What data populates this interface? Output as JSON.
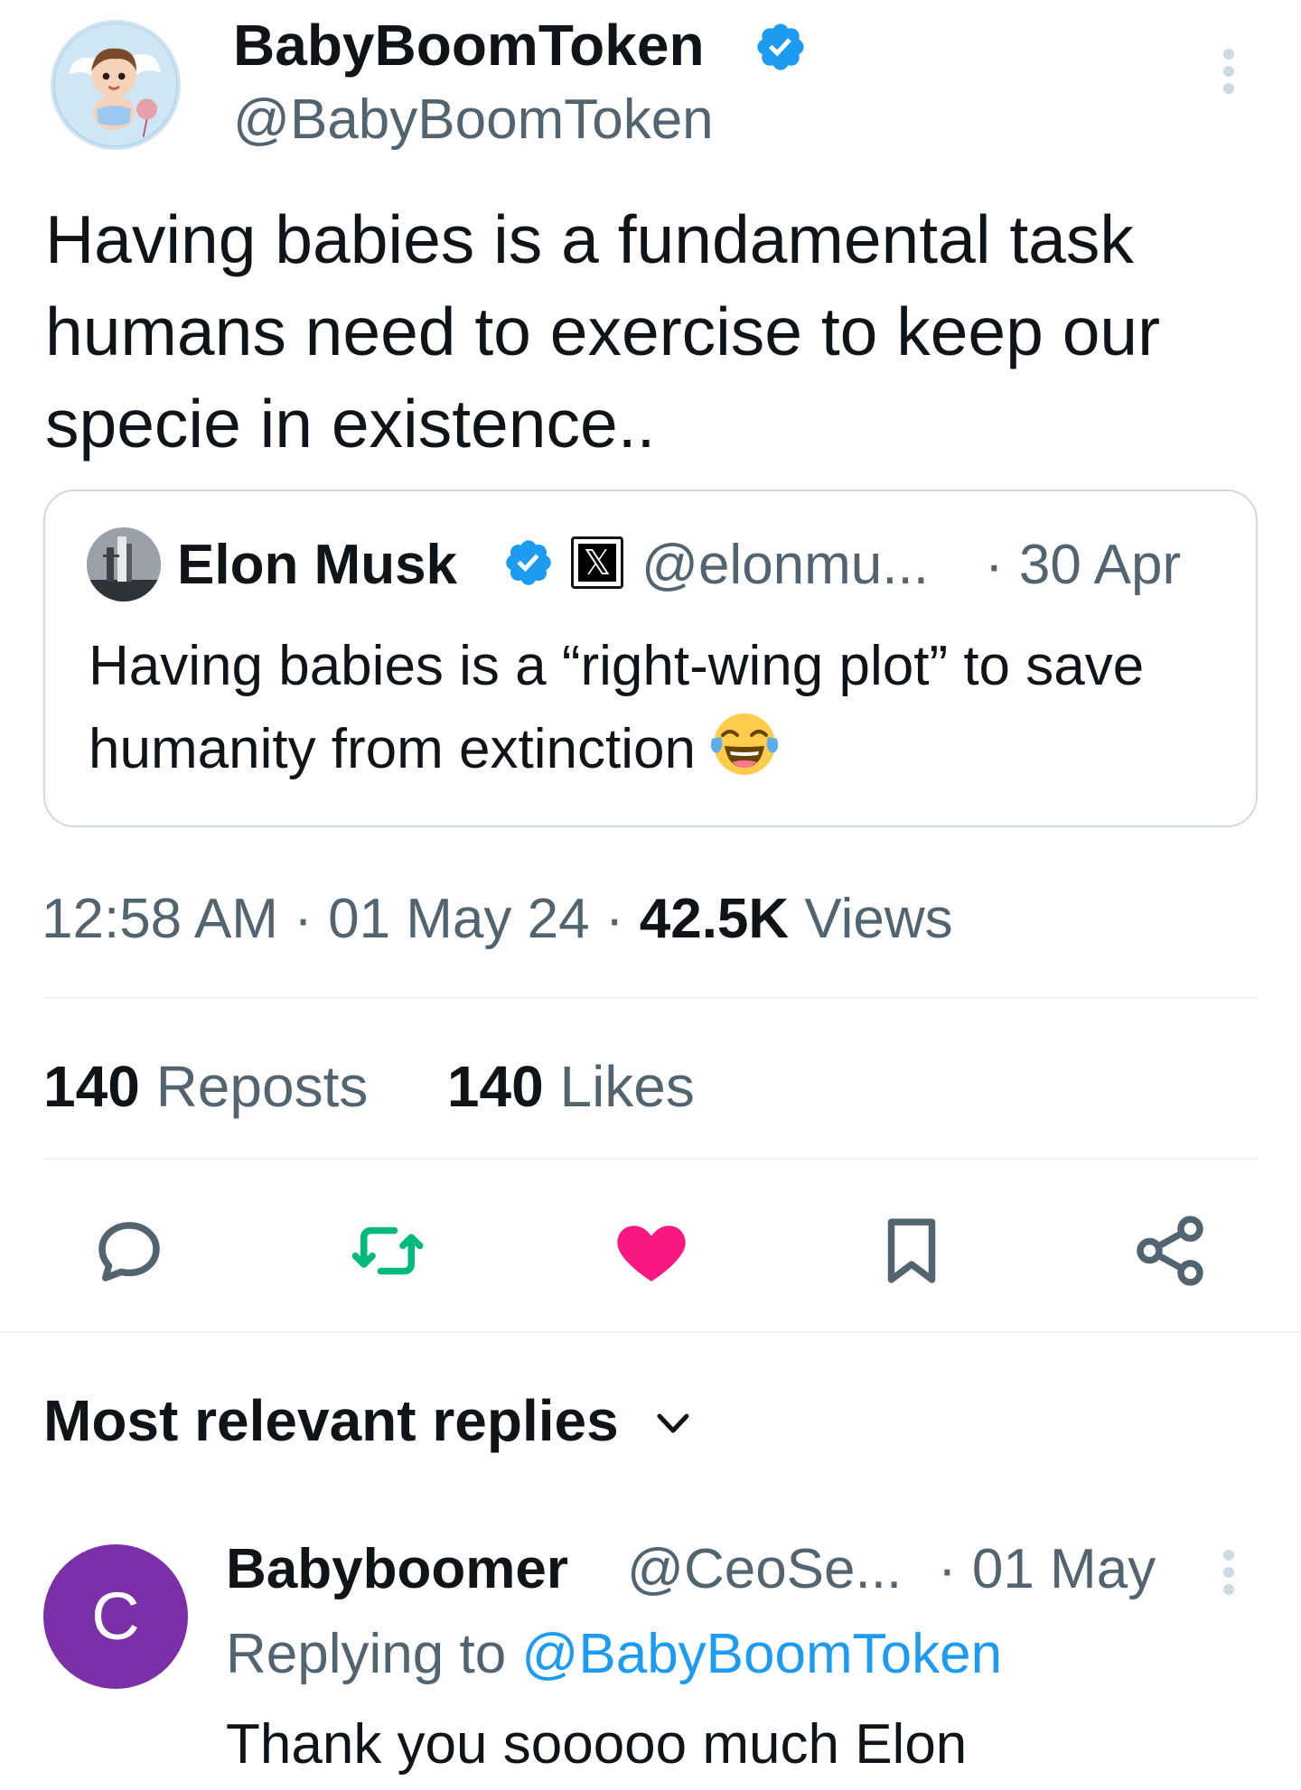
{
  "tweet": {
    "author_name": "BabyBoomToken",
    "author_handle": "@BabyBoomToken",
    "text": "Having babies is a fundamental task humans need to exercise to keep our specie in existence..",
    "time": "12:58 AM",
    "date": "01 May 24",
    "views_count": "42.5K",
    "views_label": "Views",
    "separator": "·"
  },
  "quoted_tweet": {
    "author_name": "Elon Musk",
    "author_handle": "@elonmu...",
    "date": "· 30 Apr",
    "text": "Having babies is a “right-wing plot” to save humanity from extinction",
    "emoji": "face-with-tears-of-joy",
    "affiliate_badge": "𝕏"
  },
  "stats": {
    "reposts_count": "140",
    "reposts_label": "Reposts",
    "likes_count": "140",
    "likes_label": "Likes"
  },
  "actions": {
    "reply_icon": "reply-bubble-icon",
    "repost_icon": "repost-arrows-icon",
    "like_icon": "heart-icon",
    "bookmark_icon": "bookmark-icon",
    "share_icon": "share-nodes-icon",
    "like_active": true
  },
  "replies": {
    "heading": "Most relevant replies",
    "items": [
      {
        "avatar_initial": "C",
        "author_name": "Babyboomer",
        "author_handle": "@CeoSe...",
        "date": "· 01 May",
        "replying_to_label": "Replying to",
        "replying_to_handle": "@BabyBoomToken",
        "text": "Thank you sooooo much Elon"
      }
    ]
  },
  "colors": {
    "verified_blue": "#1d9bf0",
    "secondary_text": "#536471",
    "primary_text": "#0f1419",
    "repost_green": "#00ba7c",
    "like_pink": "#f91880",
    "reply_avatar_purple": "#7b2fa8"
  }
}
